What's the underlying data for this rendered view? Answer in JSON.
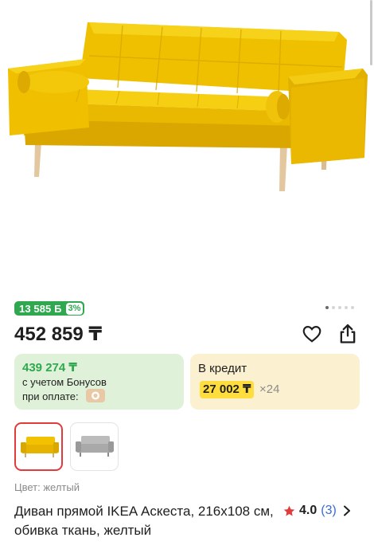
{
  "gallery": {
    "dots_total": 5,
    "active_index": 0
  },
  "bonus": {
    "amount": "13 585 Б",
    "percent": "3%"
  },
  "price": "452 859 ₸",
  "bonus_card": {
    "price": "439 274 ₸",
    "line1": "с учетом Бонусов",
    "line2": "при оплате:"
  },
  "credit_card": {
    "title": "В кредит",
    "monthly": "27 002 ₸",
    "term": "×24"
  },
  "color_options": [
    {
      "name": "yellow-sofa-thumbnail",
      "selected": true
    },
    {
      "name": "gray-sofa-thumbnail",
      "selected": false
    }
  ],
  "color_label": "Цвет: желтый",
  "product_title": "Диван прямой IKEA Аскеста, 216x108 см, обивка ткань, желтый",
  "rating": {
    "value": "4.0",
    "count": "(3)"
  },
  "colors": {
    "accent_green": "#2fa84f",
    "selected_border": "#e23b3b",
    "credit_highlight": "#ffdd3d",
    "sofa_yellow": "#f2c200",
    "rating_link": "#3b6ccf"
  },
  "icons": [
    "heart-icon",
    "share-icon",
    "star-icon",
    "chevron-right-icon",
    "payment-icon"
  ]
}
